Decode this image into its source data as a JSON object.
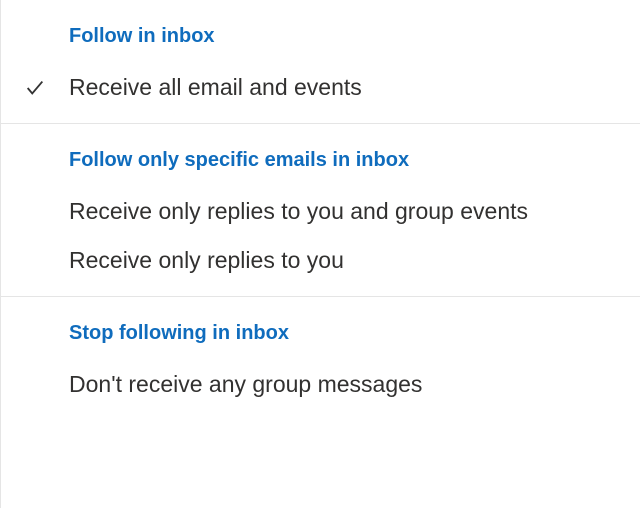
{
  "colors": {
    "link": "#0f6cbd",
    "text": "#323130",
    "border": "#e5e5e5"
  },
  "sections": [
    {
      "header": "Follow in inbox",
      "items": [
        {
          "label": "Receive all email and events",
          "selected": true
        }
      ]
    },
    {
      "header": "Follow only specific emails in inbox",
      "items": [
        {
          "label": "Receive only replies to you and group events",
          "selected": false
        },
        {
          "label": "Receive only replies to you",
          "selected": false
        }
      ]
    },
    {
      "header": "Stop following in inbox",
      "items": [
        {
          "label": "Don't receive any group messages",
          "selected": false
        }
      ]
    }
  ]
}
